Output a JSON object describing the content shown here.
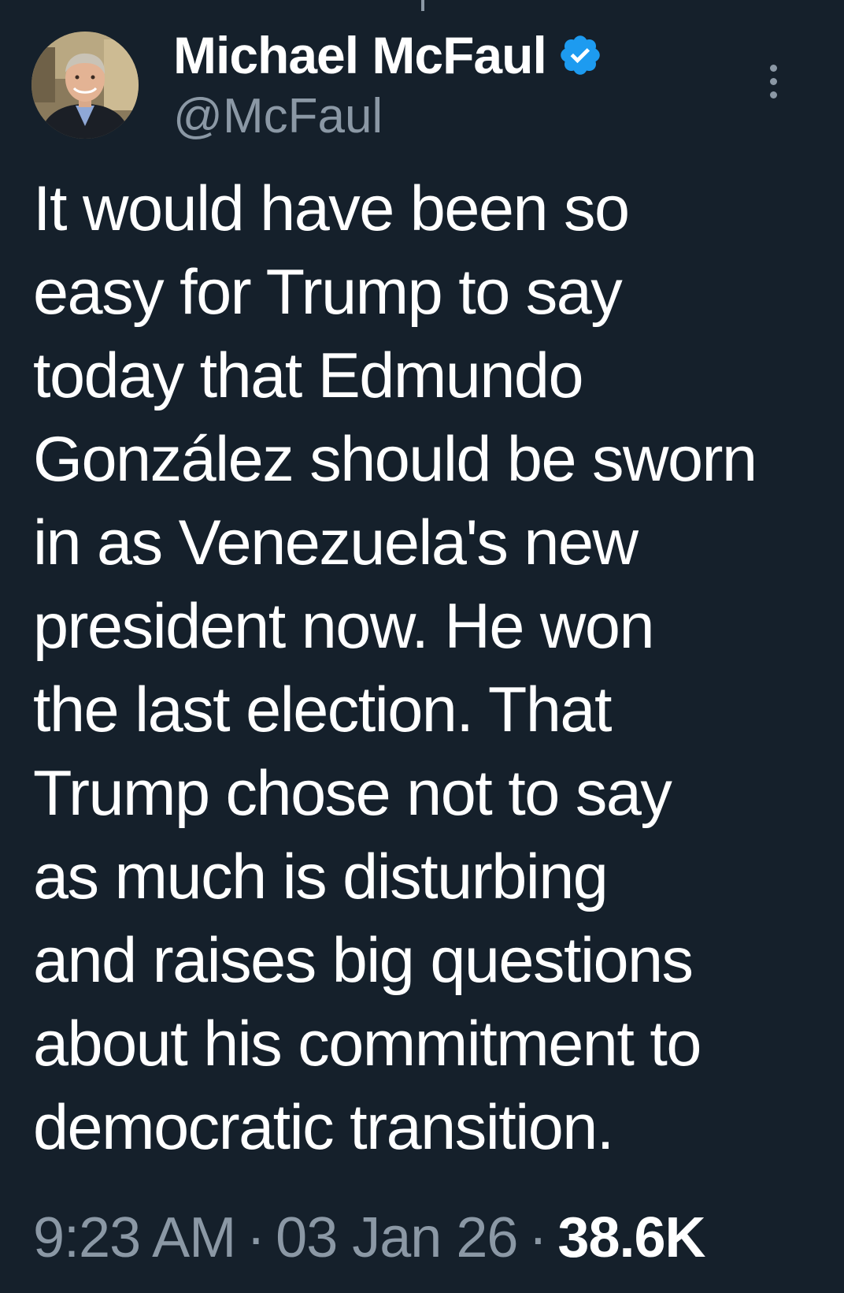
{
  "tweet": {
    "author": {
      "display_name": "Michael McFaul",
      "handle": "@McFaul",
      "verified": true,
      "verified_icon": "verified-badge-icon",
      "verified_color": "#1d9bf0"
    },
    "text": "It would have been so\neasy for Trump to say\ntoday that Edmundo\nGonzález should be sworn\nin as Venezuela's new\npresident now.  He won\nthe last election. That\nTrump chose not to say\nas much is disturbing\nand raises big questions\nabout his commitment to\ndemocratic transition.",
    "time": "9:23 AM",
    "separator": "·",
    "date": "03 Jan 26",
    "views": "38.6K"
  },
  "icons": {
    "more": "more-vertical-icon"
  },
  "colors": {
    "background": "#15202b",
    "text_primary": "#ffffff",
    "text_secondary": "#8b98a5"
  }
}
